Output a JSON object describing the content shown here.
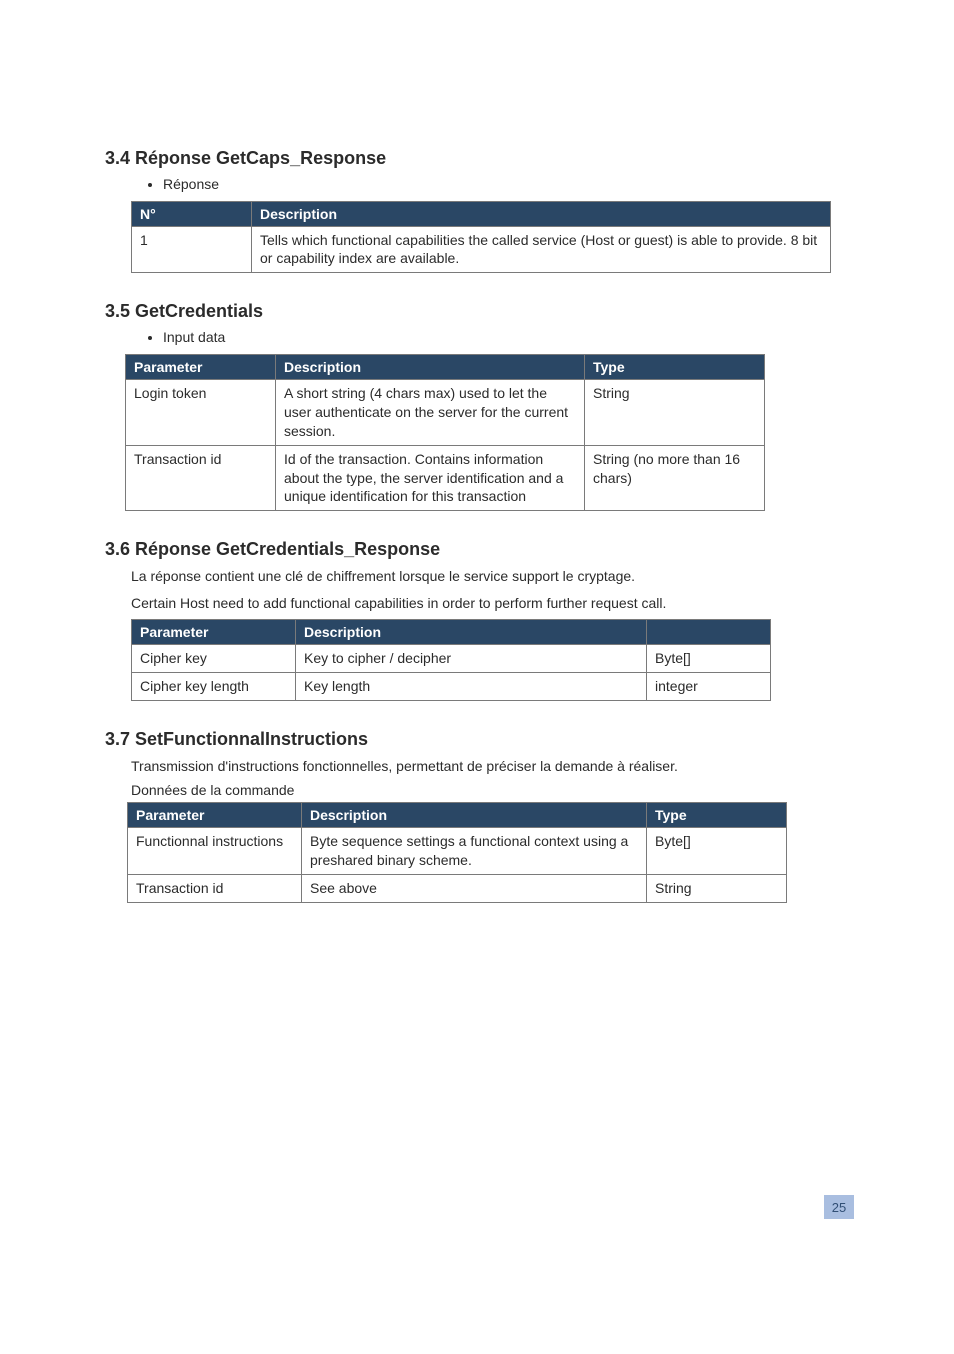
{
  "section1": {
    "title": "3.4 Réponse GetCaps_Response",
    "intro": "Réponse",
    "table": {
      "headers": [
        "N°",
        "Description"
      ],
      "rows": [
        [
          "1",
          "Tells which functional capabilities the called service (Host or guest) is able to provide. 8 bit or capability index are available."
        ]
      ]
    }
  },
  "section2": {
    "title": "3.5 GetCredentials",
    "intro": "Input data",
    "table": {
      "headers": [
        "Parameter",
        "Description",
        "Type"
      ],
      "rows": [
        [
          "Login token",
          "A short string (4 chars max) used to let the user authenticate on the server for the current session.",
          "String"
        ],
        [
          "Transaction id",
          "Id of the transaction. Contains information about the type, the server identification and a unique identification for this transaction",
          "String (no more than 16 chars)"
        ]
      ]
    }
  },
  "section3": {
    "title": "3.6 Réponse GetCredentials_Response",
    "body1": "La réponse contient une clé de chiffrement lorsque le service support le cryptage.",
    "body2": "Certain Host need to add functional capabilities in order to perform further request call.",
    "table": {
      "headers": [
        "Parameter",
        "Description",
        ""
      ],
      "rows": [
        [
          "Cipher key",
          "Key to cipher / decipher",
          "Byte[]"
        ],
        [
          "Cipher key length",
          "Key length",
          "integer"
        ]
      ]
    }
  },
  "section4": {
    "title": "3.7 SetFunctionnalInstructions",
    "body1": "Transmission d'instructions fonctionnelles, permettant de préciser la demande à réaliser.",
    "caption": "Données de la commande",
    "table": {
      "headers": [
        "Parameter",
        "Description",
        "Type"
      ],
      "rows": [
        [
          "Functionnal instructions",
          "Byte sequence settings a functional context using a preshared binary scheme.",
          "Byte[]"
        ],
        [
          "Transaction id",
          "See above",
          "String"
        ]
      ]
    }
  },
  "pageNumber": "25"
}
